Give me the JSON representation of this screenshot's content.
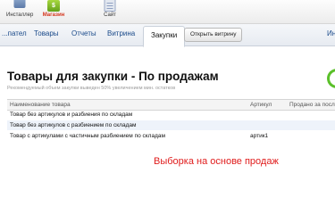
{
  "apps": [
    {
      "label": "Инсталлер",
      "icon": "installer-icon"
    },
    {
      "label": "Магазин",
      "icon": "store-icon",
      "badge": "$",
      "active": true
    },
    {
      "label": "Сайт",
      "icon": "site-icon"
    }
  ],
  "tabs": [
    "...пател",
    "Товары",
    "Отчеты",
    "Витрина",
    "Закупки"
  ],
  "active_tab": "Закупки",
  "open_showcase_button": "Открыть витрину",
  "tab_overflow": "Инте",
  "page": {
    "title": "Товары для закупки - По продажам",
    "subtitle": "Рекомендуемый объем закупки выведен 50% увеличением мин. остатков"
  },
  "table": {
    "columns": [
      "Наименование товара",
      "Артикул",
      "Продано за посл"
    ],
    "rows": [
      {
        "name": "Товар без артикулов и разбиения по складам",
        "article": ""
      },
      {
        "name": "Товар без артикулов с разбиением по складам",
        "article": ""
      },
      {
        "name": "Товар с артикулами с частичным разбиением по складам",
        "article": "артик1"
      }
    ]
  },
  "annotation": "Выборка на основе продаж",
  "colors": {
    "accent_green": "#5bc02a",
    "annotation_red": "#e01c1c",
    "link_blue": "#1a4a8a"
  }
}
